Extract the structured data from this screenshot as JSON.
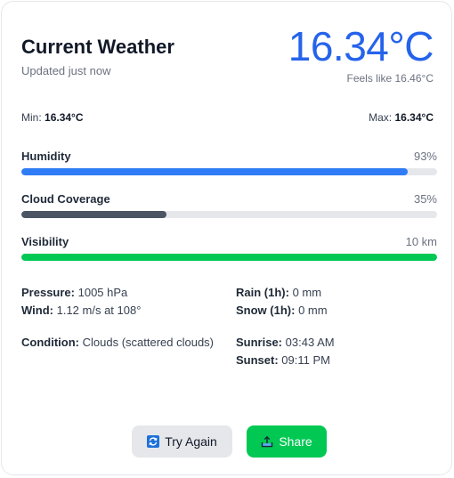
{
  "header": {
    "title": "Current Weather",
    "updated": "Updated just now",
    "temperature": "16.34°C",
    "feels_like": "Feels like 16.46°C"
  },
  "range": {
    "min_label": "Min:",
    "min_value": "16.34°C",
    "max_label": "Max:",
    "max_value": "16.34°C"
  },
  "meters": {
    "humidity": {
      "label": "Humidity",
      "value": "93%",
      "level": 0.93,
      "color": "#2f7cf6"
    },
    "cloud": {
      "label": "Cloud Coverage",
      "value": "35%",
      "level": 0.35,
      "color": "#4b5563"
    },
    "visibility": {
      "label": "Visibility",
      "value": "10 km",
      "level": 1.0,
      "color": "#00c853"
    }
  },
  "details": {
    "pressure_label": "Pressure:",
    "pressure_value": "1005 hPa",
    "wind_label": "Wind:",
    "wind_value": "1.12 m/s at 108°",
    "rain_label": "Rain (1h):",
    "rain_value": "0 mm",
    "snow_label": "Snow (1h):",
    "snow_value": "0 mm",
    "condition_label": "Condition:",
    "condition_value": "Clouds (scattered clouds)",
    "sunrise_label": "Sunrise:",
    "sunrise_value": "03:43 AM",
    "sunset_label": "Sunset:",
    "sunset_value": "09:11 PM"
  },
  "actions": {
    "try_again_label": "Try Again",
    "try_again_icon": "refresh-icon",
    "share_label": "Share",
    "share_icon": "share-upload-icon"
  },
  "colors": {
    "accent": "#2563eb",
    "share_button": "#00c853",
    "try_button": "#e5e7eb"
  }
}
